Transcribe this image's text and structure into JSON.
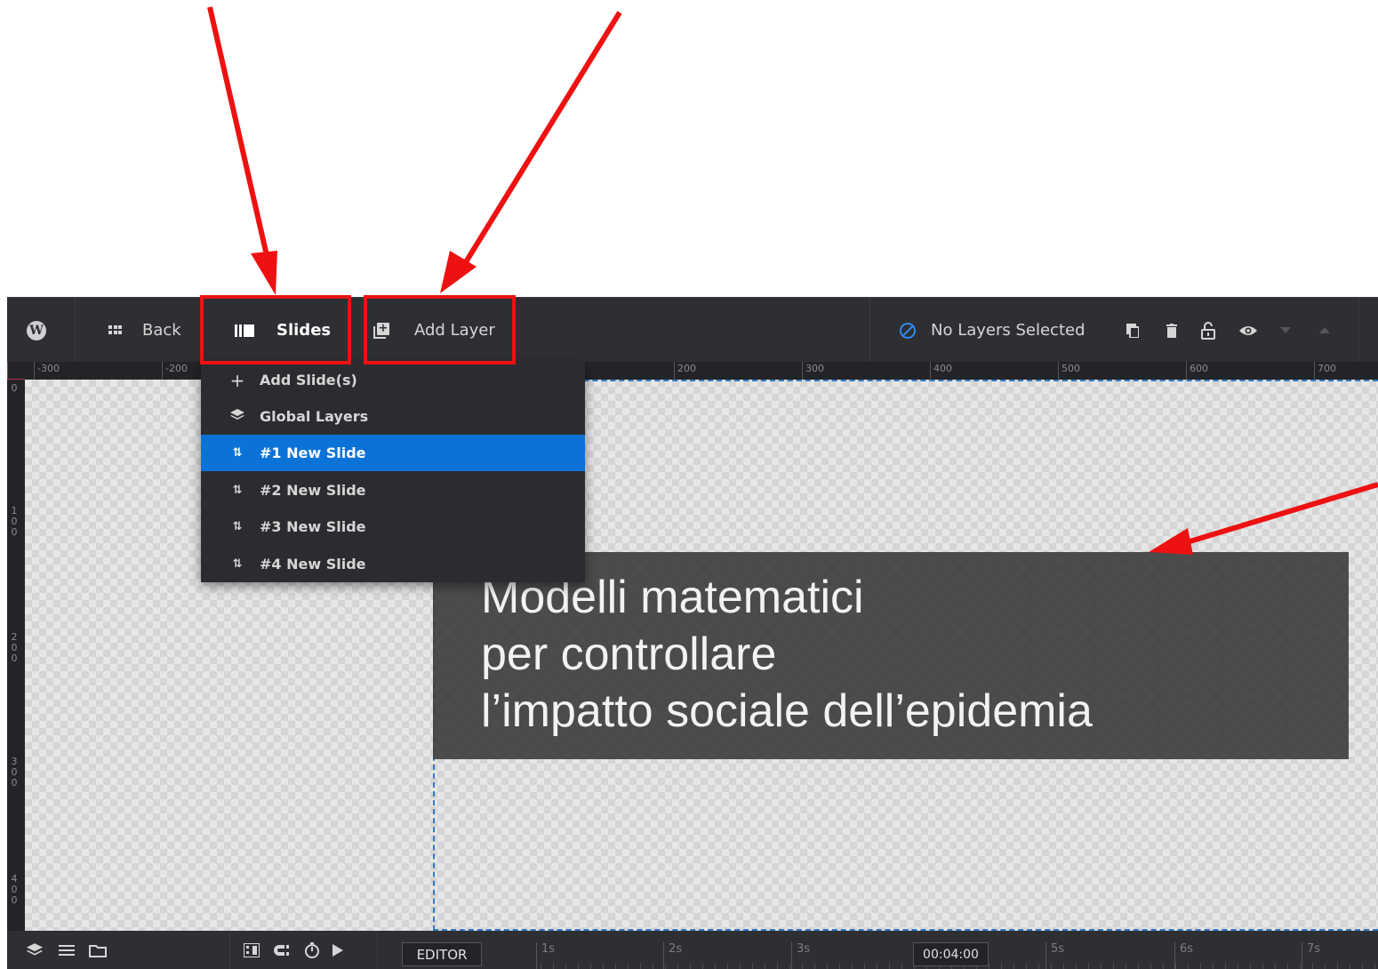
{
  "toolbar": {
    "back_label": "Back",
    "slides_label": "Slides",
    "add_layer_label": "Add Layer",
    "no_layers_label": "No Layers Selected"
  },
  "ruler": {
    "h_labels": [
      "-300",
      "-200",
      "200",
      "300",
      "400",
      "500",
      "600",
      "700"
    ],
    "v_labels": [
      "0",
      "1\n0\n0",
      "2\n0\n0",
      "3\n0\n0",
      "4\n0\n0"
    ]
  },
  "slides_menu": {
    "items": [
      {
        "label": "Add Slide(s)",
        "icon": "plus-icon"
      },
      {
        "label": "Global Layers",
        "icon": "layers-icon"
      },
      {
        "label": "#1 New Slide",
        "icon": "sort-icon",
        "active": true
      },
      {
        "label": "#2 New Slide",
        "icon": "sort-icon"
      },
      {
        "label": "#3 New Slide",
        "icon": "sort-icon"
      },
      {
        "label": "#4 New Slide",
        "icon": "sort-icon"
      }
    ]
  },
  "layer_text": {
    "line1": "Modelli matematici",
    "line2": "per controllare",
    "line3": "l’impatto sociale dell’epidemia"
  },
  "timeline": {
    "editor_label": "EDITOR",
    "time": "00:04:00",
    "ticks": [
      "1s",
      "2s",
      "3s",
      "5s",
      "6s",
      "7s"
    ]
  },
  "colors": {
    "accent": "#0b73d8",
    "annotation": "#ee1111",
    "toolbar_bg": "#2e2f33"
  }
}
